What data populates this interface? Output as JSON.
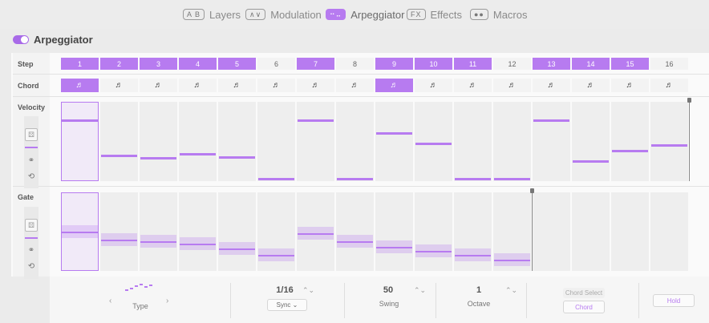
{
  "tabs": [
    {
      "badge": "A B",
      "label": "Layers",
      "active": false
    },
    {
      "badge": "∧∨",
      "label": "Modulation",
      "active": false
    },
    {
      "badge": "⠒⠤",
      "label": "Arpeggiator",
      "active": true
    },
    {
      "badge": "FX",
      "label": "Effects",
      "active": false
    },
    {
      "badge": "●●",
      "label": "Macros",
      "active": false
    }
  ],
  "section": {
    "title": "Arpeggiator",
    "enabled": true
  },
  "rows": {
    "step": "Step",
    "chord": "Chord",
    "velocity": "Velocity",
    "gate": "Gate"
  },
  "steps": [
    {
      "n": "1",
      "on": true
    },
    {
      "n": "2",
      "on": true
    },
    {
      "n": "3",
      "on": true
    },
    {
      "n": "4",
      "on": true
    },
    {
      "n": "5",
      "on": true
    },
    {
      "n": "6",
      "on": false
    },
    {
      "n": "7",
      "on": true
    },
    {
      "n": "8",
      "on": false
    },
    {
      "n": "9",
      "on": true
    },
    {
      "n": "10",
      "on": true
    },
    {
      "n": "11",
      "on": true
    },
    {
      "n": "12",
      "on": false
    },
    {
      "n": "13",
      "on": true
    },
    {
      "n": "14",
      "on": true
    },
    {
      "n": "15",
      "on": true
    },
    {
      "n": "16",
      "on": false
    }
  ],
  "chords_on": [
    true,
    false,
    false,
    false,
    false,
    false,
    false,
    false,
    true,
    false,
    false,
    false,
    false,
    false,
    false,
    false
  ],
  "chord_glyph": "♬",
  "velocity_levels": [
    0.79,
    0.33,
    0.29,
    0.35,
    0.31,
    0.02,
    0.79,
    0.02,
    0.62,
    0.48,
    0.02,
    0.02,
    0.79,
    0.25,
    0.39,
    0.46
  ],
  "gate_levels": [
    0.5,
    0.38,
    0.36,
    0.32,
    0.26,
    0.16,
    0.48,
    0.36,
    0.28,
    0.22,
    0.16,
    0.09,
    0,
    0,
    0,
    0
  ],
  "selected_step": 1,
  "velocity_loop_end": 16,
  "gate_loop_end": 12,
  "controls": {
    "type": {
      "label": "Type",
      "prev": "‹",
      "next": "›"
    },
    "rate": {
      "value": "1/16",
      "sync": "Sync",
      "sync_caret": "⌄"
    },
    "swing": {
      "value": "50",
      "label": "Swing"
    },
    "octave": {
      "value": "1",
      "label": "Octave"
    },
    "chord_select": {
      "label": "Chord Select",
      "button": "Chord"
    },
    "hold": {
      "label": "Hold"
    },
    "spin_glyph": "⌃⌄"
  },
  "side_icons": {
    "dice": "⚄",
    "link": "⚭",
    "cycle": "⟲"
  },
  "colors": {
    "accent": "#b77bf0",
    "lane_bg": "#eeeeee"
  }
}
